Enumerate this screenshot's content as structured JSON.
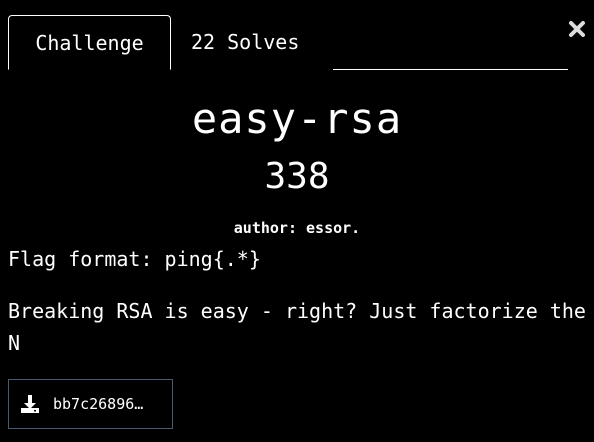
{
  "tabs": [
    {
      "label": "Challenge",
      "active": true
    },
    {
      "label": "22 Solves",
      "active": false
    }
  ],
  "close": {
    "icon": "close-icon"
  },
  "challenge": {
    "title": "easy-rsa",
    "points": "338",
    "author": "author: essor.",
    "flag_format": "Flag format: ping{.*}",
    "description": "Breaking RSA is easy - right? Just factorize the N"
  },
  "file": {
    "icon": "download-icon",
    "name": "bb7c26896…"
  },
  "colors": {
    "background": "#000000",
    "text": "#ffffff",
    "file_border": "#4a5a72"
  }
}
